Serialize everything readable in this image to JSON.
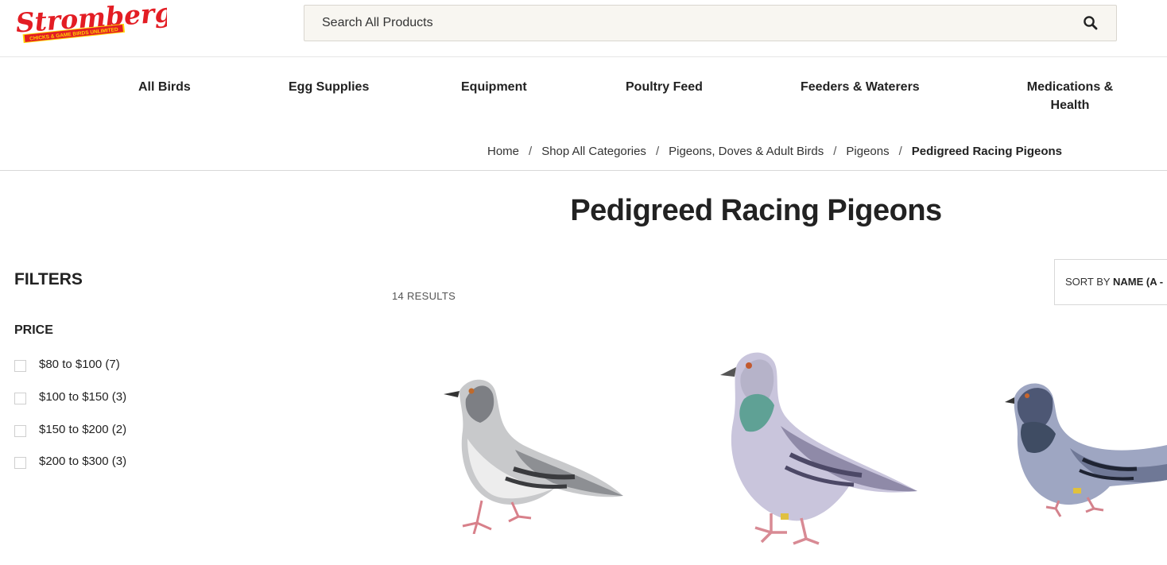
{
  "header": {
    "logo_text": "Stromberg's",
    "logo_tagline": "CHICKS & GAME BIRDS UNLIMITED",
    "search_placeholder": "Search All Products",
    "search_icon": "search-icon",
    "brand_red": "#e31d24",
    "brand_yellow": "#ffd200"
  },
  "nav": {
    "items": [
      {
        "label": "All Birds"
      },
      {
        "label": "Egg Supplies"
      },
      {
        "label": "Equipment"
      },
      {
        "label": "Poultry Feed"
      },
      {
        "label": "Feeders & Waterers"
      },
      {
        "label": "Medications &",
        "label2": "Health"
      }
    ]
  },
  "breadcrumb": {
    "items": [
      "Home",
      "Shop All Categories",
      "Pigeons, Doves & Adult Birds",
      "Pigeons"
    ],
    "current": "Pedigreed Racing Pigeons",
    "separator": "/"
  },
  "page": {
    "title": "Pedigreed Racing Pigeons"
  },
  "filters": {
    "title": "FILTERS",
    "price": {
      "title": "PRICE",
      "options": [
        {
          "label": "$80 to $100 (7)"
        },
        {
          "label": "$100 to $150 (3)"
        },
        {
          "label": "$150 to $200 (2)"
        },
        {
          "label": "$200 to $300 (3)"
        }
      ]
    }
  },
  "results": {
    "count_text": "14 RESULTS"
  },
  "sort": {
    "prefix": "SORT BY",
    "value": "NAME (A -"
  }
}
